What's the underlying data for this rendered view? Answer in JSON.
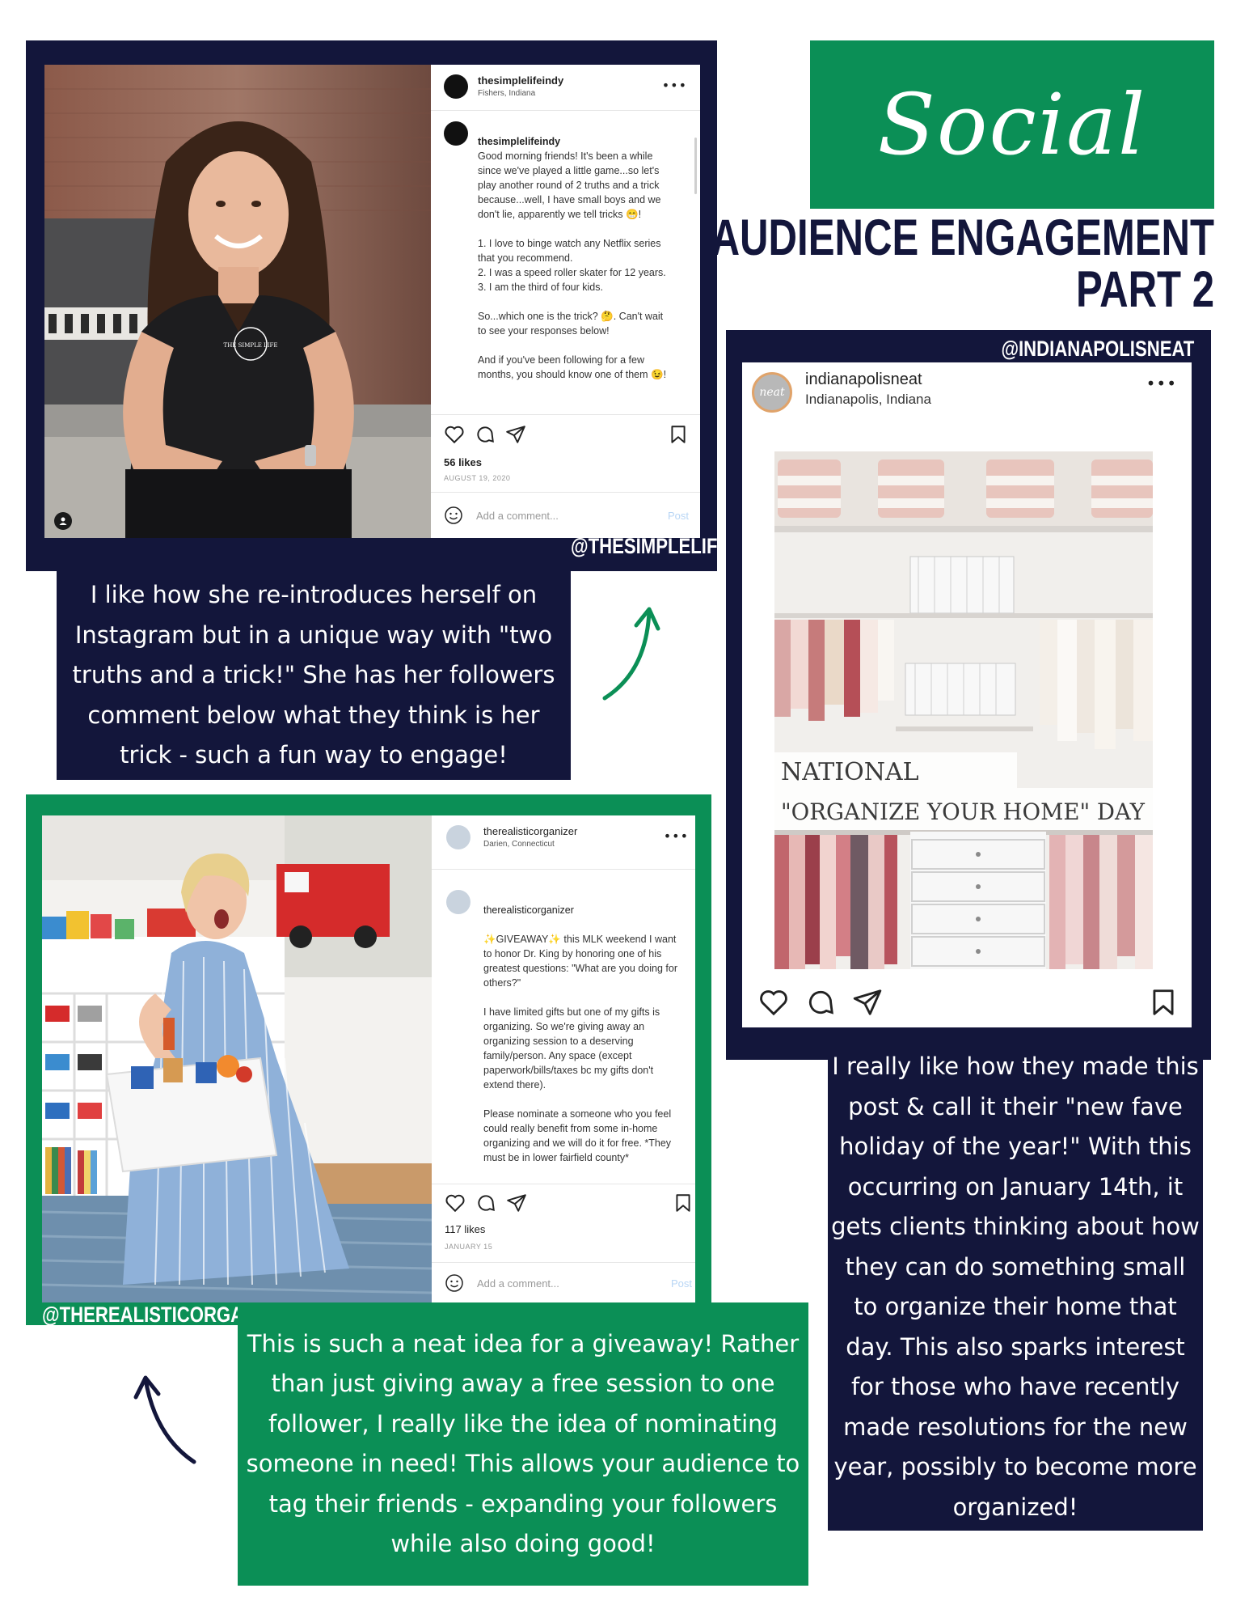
{
  "header": {
    "script_title": "Social",
    "title_line1": "AUDIENCE ENGAGEMENT",
    "title_line2": "PART 2"
  },
  "post1": {
    "username": "thesimplelifeindy",
    "location": "Fishers, Indiana",
    "caption_user": "thesimplelifeindy",
    "caption_text": "Good morning friends! It's been a while since we've played a little game...so let's play another round of 2 truths and a trick because...well, I have small boys and we don't lie, apparently we tell tricks 😁!\n\n1. I love to binge watch any Netflix series that you recommend.\n2. I was a speed roller skater for 12 years.\n3. I am the third of four kids.\n\nSo...which one is the trick? 🤔. Can't wait to see your responses below!\n\nAnd if you've been following for a few months, you should know one of them 😉!",
    "likes": "56 likes",
    "date": "AUGUST 19, 2020",
    "add_comment": "Add a comment...",
    "post_button": "Post",
    "logo_text": "THE SIMPLE LIFE",
    "handle": "@THESIMPLELIFE",
    "commentary": "I like how she re-introduces herself on Instagram but in a unique way with \"two truths and a trick!\"  She has her followers comment below what they think is her trick - such a fun way to engage!"
  },
  "post2": {
    "username": "indianapolisneat",
    "location": "Indianapolis, Indiana",
    "avatar_text": "neat",
    "handle": "@INDIANAPOLISNEAT",
    "image_text_line1": "NATIONAL",
    "image_text_line2": "\"ORGANIZE YOUR HOME\" DAY",
    "commentary": "I really like how they made this post & call it their \"new fave holiday of the year!\"  With this occurring on January 14th, it gets clients thinking about how they can do something small to organize their home that day.  This also sparks interest for those who have recently made resolutions for the new year, possibly to become more organized!"
  },
  "post3": {
    "username": "therealisticorganizer",
    "location": "Darien, Connecticut",
    "caption_user": "therealisticorganizer",
    "caption_text": "✨GIVEAWAY✨ this MLK weekend I want to honor Dr. King by honoring one of his greatest questions: \"What are you doing for others?\"\n\nI have limited gifts but one of my gifts is organizing. So we're giving away an organizing session to a deserving family/person. Any space (except paperwork/bills/taxes bc my gifts don't extend there).\n\nPlease nominate a someone who you feel could really benefit from some in-home organizing and we will do it for free. *They must be in lower fairfield county*\n\nWe will select a winner and",
    "likes": "117 likes",
    "date": "JANUARY 15",
    "add_comment": "Add a comment...",
    "post_button": "Post",
    "handle": "@THEREALISTICORGANIZER",
    "commentary": "This is such a neat idea for a giveaway!  Rather than just giving away a free session to one follower, I really like the idea of nominating someone in need!  This allows your audience to tag their friends - expanding your followers while also doing good!"
  },
  "colors": {
    "navy": "#13163b",
    "green": "#0b8f56",
    "white": "#ffffff"
  },
  "icons": [
    "heart-icon",
    "comment-icon",
    "share-icon",
    "bookmark-icon",
    "more-icon",
    "emoji-icon",
    "user-tag-icon",
    "arrow-up-icon",
    "arrow-curve-icon"
  ]
}
